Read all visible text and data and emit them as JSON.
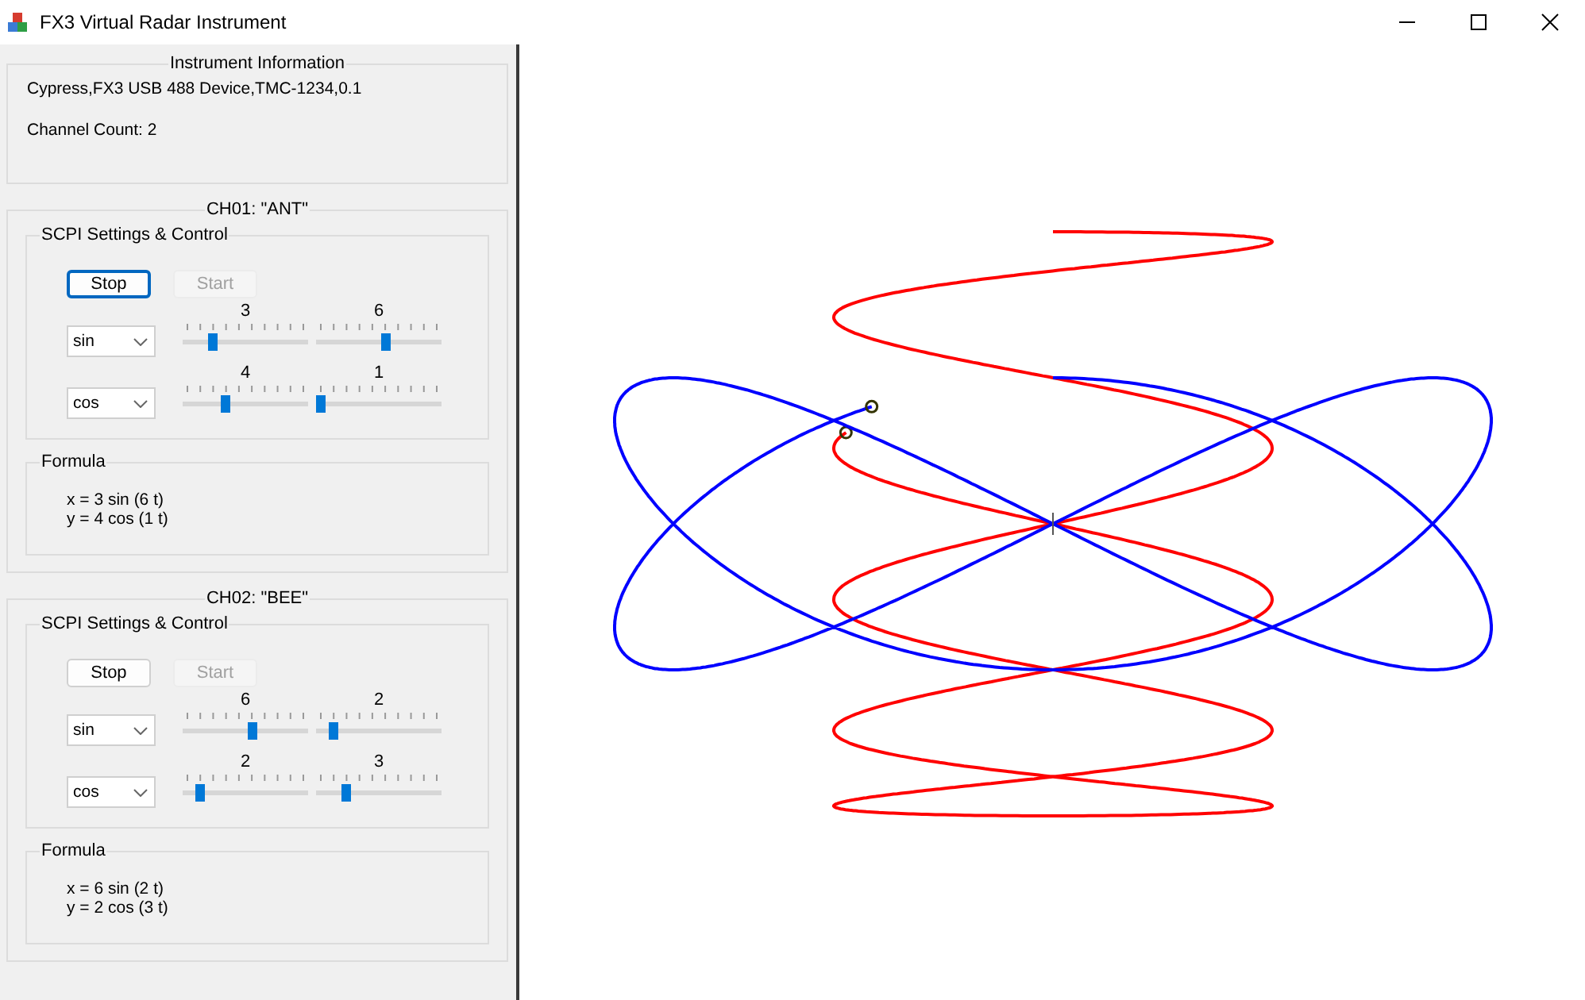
{
  "window": {
    "title": "FX3 Virtual Radar Instrument"
  },
  "instrument_info": {
    "title": "Instrument Information",
    "identity": "Cypress,FX3 USB 488 Device,TMC-1234,0.1",
    "channel_count": "Channel Count: 2"
  },
  "channels": [
    {
      "title": "CH01: \"ANT\"",
      "color": "#ff0000",
      "settings": {
        "title": "SCPI Settings & Control",
        "stop": {
          "label": "Stop",
          "disabled": false,
          "focused": true
        },
        "start": {
          "label": "Start",
          "disabled": true,
          "focused": false
        },
        "rows": [
          {
            "function": "sin",
            "sliders": [
              {
                "value": "3",
                "level": 0.22
              },
              {
                "value": "6",
                "level": 0.56
              }
            ]
          },
          {
            "function": "cos",
            "sliders": [
              {
                "value": "4",
                "level": 0.33
              },
              {
                "value": "1",
                "level": 0.0
              }
            ]
          }
        ]
      },
      "formula": {
        "title": "Formula",
        "lines": [
          "x = 3 sin (6 t)",
          "y = 4 cos (1 t)"
        ]
      }
    },
    {
      "title": "CH02: \"BEE\"",
      "color": "#0000ff",
      "settings": {
        "title": "SCPI Settings & Control",
        "stop": {
          "label": "Stop",
          "disabled": false,
          "focused": false
        },
        "start": {
          "label": "Start",
          "disabled": true,
          "focused": false
        },
        "rows": [
          {
            "function": "sin",
            "sliders": [
              {
                "value": "6",
                "level": 0.56
              },
              {
                "value": "2",
                "level": 0.11
              }
            ]
          },
          {
            "function": "cos",
            "sliders": [
              {
                "value": "2",
                "level": 0.11
              },
              {
                "value": "3",
                "level": 0.22
              }
            ]
          }
        ]
      },
      "formula": {
        "title": "Formula",
        "lines": [
          "x = 6 sin (2 t)",
          "y = 2 cos (3 t)"
        ]
      }
    }
  ]
}
